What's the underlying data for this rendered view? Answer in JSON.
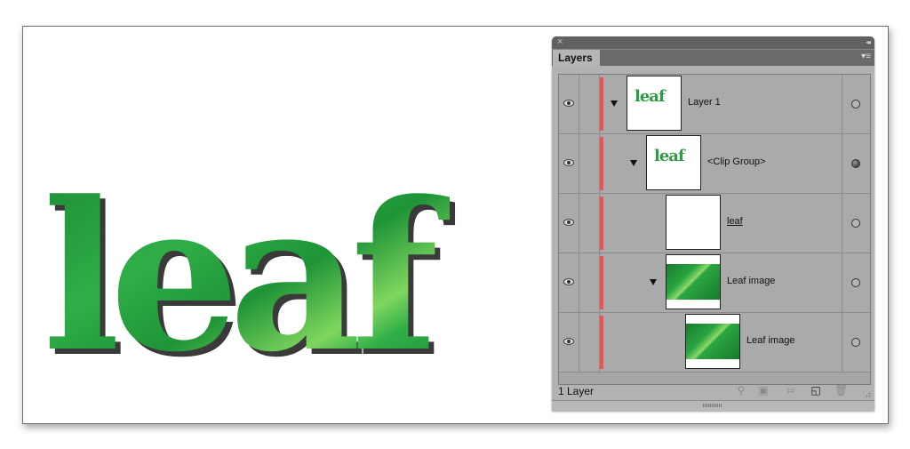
{
  "artwork": {
    "text": "leaf",
    "fill_colors": {
      "dark": "#1a7a30",
      "mid": "#2aa540",
      "light": "#7fd65e"
    },
    "shadow_color": "#3a3a3a"
  },
  "panel": {
    "title_close": "×",
    "title_collapse": "◂◂",
    "tab_label": "Layers",
    "menu_icon": "≡",
    "layer_count": "1 Layer",
    "layer_color": "#ef5350",
    "rows": [
      {
        "name": "Layer 1",
        "indent": 0,
        "expanded": true,
        "thumb": "leaf-text",
        "target": "empty",
        "underline": false
      },
      {
        "name": "<Clip Group>",
        "indent": 1,
        "expanded": true,
        "thumb": "leaf-text",
        "target": "filled",
        "underline": false
      },
      {
        "name": "leaf",
        "indent": 2,
        "expanded": false,
        "thumb": "blank",
        "target": "empty",
        "underline": true
      },
      {
        "name": "Leaf image",
        "indent": 2,
        "expanded": true,
        "thumb": "photo",
        "target": "empty",
        "underline": false
      },
      {
        "name": "Leaf image",
        "indent": 3,
        "expanded": false,
        "thumb": "photo",
        "target": "empty",
        "underline": false
      }
    ],
    "thumb_text": "leaf",
    "footer_icons": [
      "search-icon",
      "make-clipping-mask-icon",
      "move-to-layer-icon",
      "new-sublayer-icon",
      "delete-icon"
    ]
  }
}
